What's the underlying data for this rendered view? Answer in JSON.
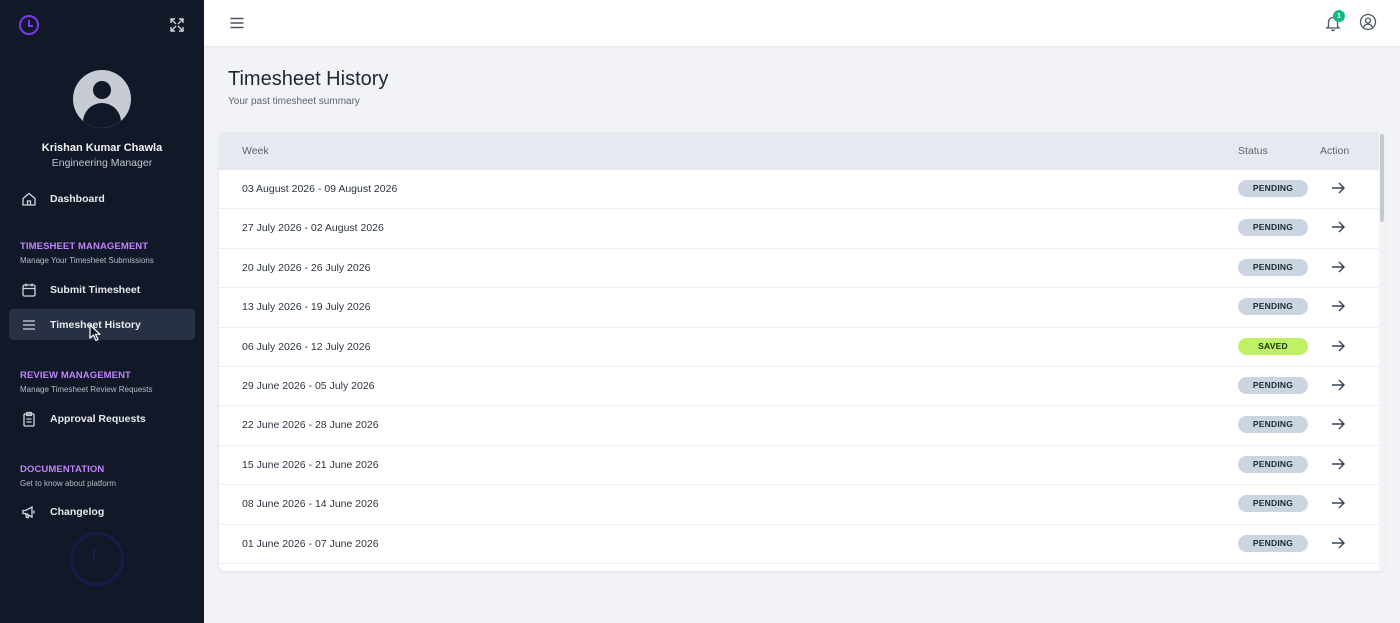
{
  "sidebar": {
    "user_name": "Krishan Kumar Chawla",
    "user_role": "Engineering Manager",
    "dashboard_label": "Dashboard",
    "sections": [
      {
        "title": "TIMESHEET MANAGEMENT",
        "subtitle": "Manage Your Timesheet Submissions"
      },
      {
        "title": "REVIEW MANAGEMENT",
        "subtitle": "Manage Timesheet Review Requests"
      },
      {
        "title": "DOCUMENTATION",
        "subtitle": "Get to know about platform"
      }
    ],
    "items": {
      "submit_timesheet": "Submit Timesheet",
      "timesheet_history": "Timesheet History",
      "approval_requests": "Approval Requests",
      "changelog": "Changelog"
    },
    "active_item": "Timesheet History"
  },
  "topbar": {
    "notification_count": "1"
  },
  "page": {
    "title": "Timesheet History",
    "subtitle": "Your past timesheet summary"
  },
  "table": {
    "columns": {
      "week": "Week",
      "status": "Status",
      "action": "Action"
    },
    "rows": [
      {
        "week": "03 August 2026 - 09 August 2026",
        "status": "PENDING"
      },
      {
        "week": "27 July 2026 - 02 August 2026",
        "status": "PENDING"
      },
      {
        "week": "20 July 2026 - 26 July 2026",
        "status": "PENDING"
      },
      {
        "week": "13 July 2026 - 19 July 2026",
        "status": "PENDING"
      },
      {
        "week": "06 July 2026 - 12 July 2026",
        "status": "SAVED"
      },
      {
        "week": "29 June 2026 - 05 July 2026",
        "status": "PENDING"
      },
      {
        "week": "22 June 2026 - 28 June 2026",
        "status": "PENDING"
      },
      {
        "week": "15 June 2026 - 21 June 2026",
        "status": "PENDING"
      },
      {
        "week": "08 June 2026 - 14 June 2026",
        "status": "PENDING"
      },
      {
        "week": "01 June 2026 - 07 June 2026",
        "status": "PENDING"
      }
    ]
  },
  "colors": {
    "sidebar_bg": "#111827",
    "accent": "#c084fc",
    "pending_badge": "#cbd5e1",
    "saved_badge": "#bef264",
    "notification_badge": "#10b981"
  }
}
